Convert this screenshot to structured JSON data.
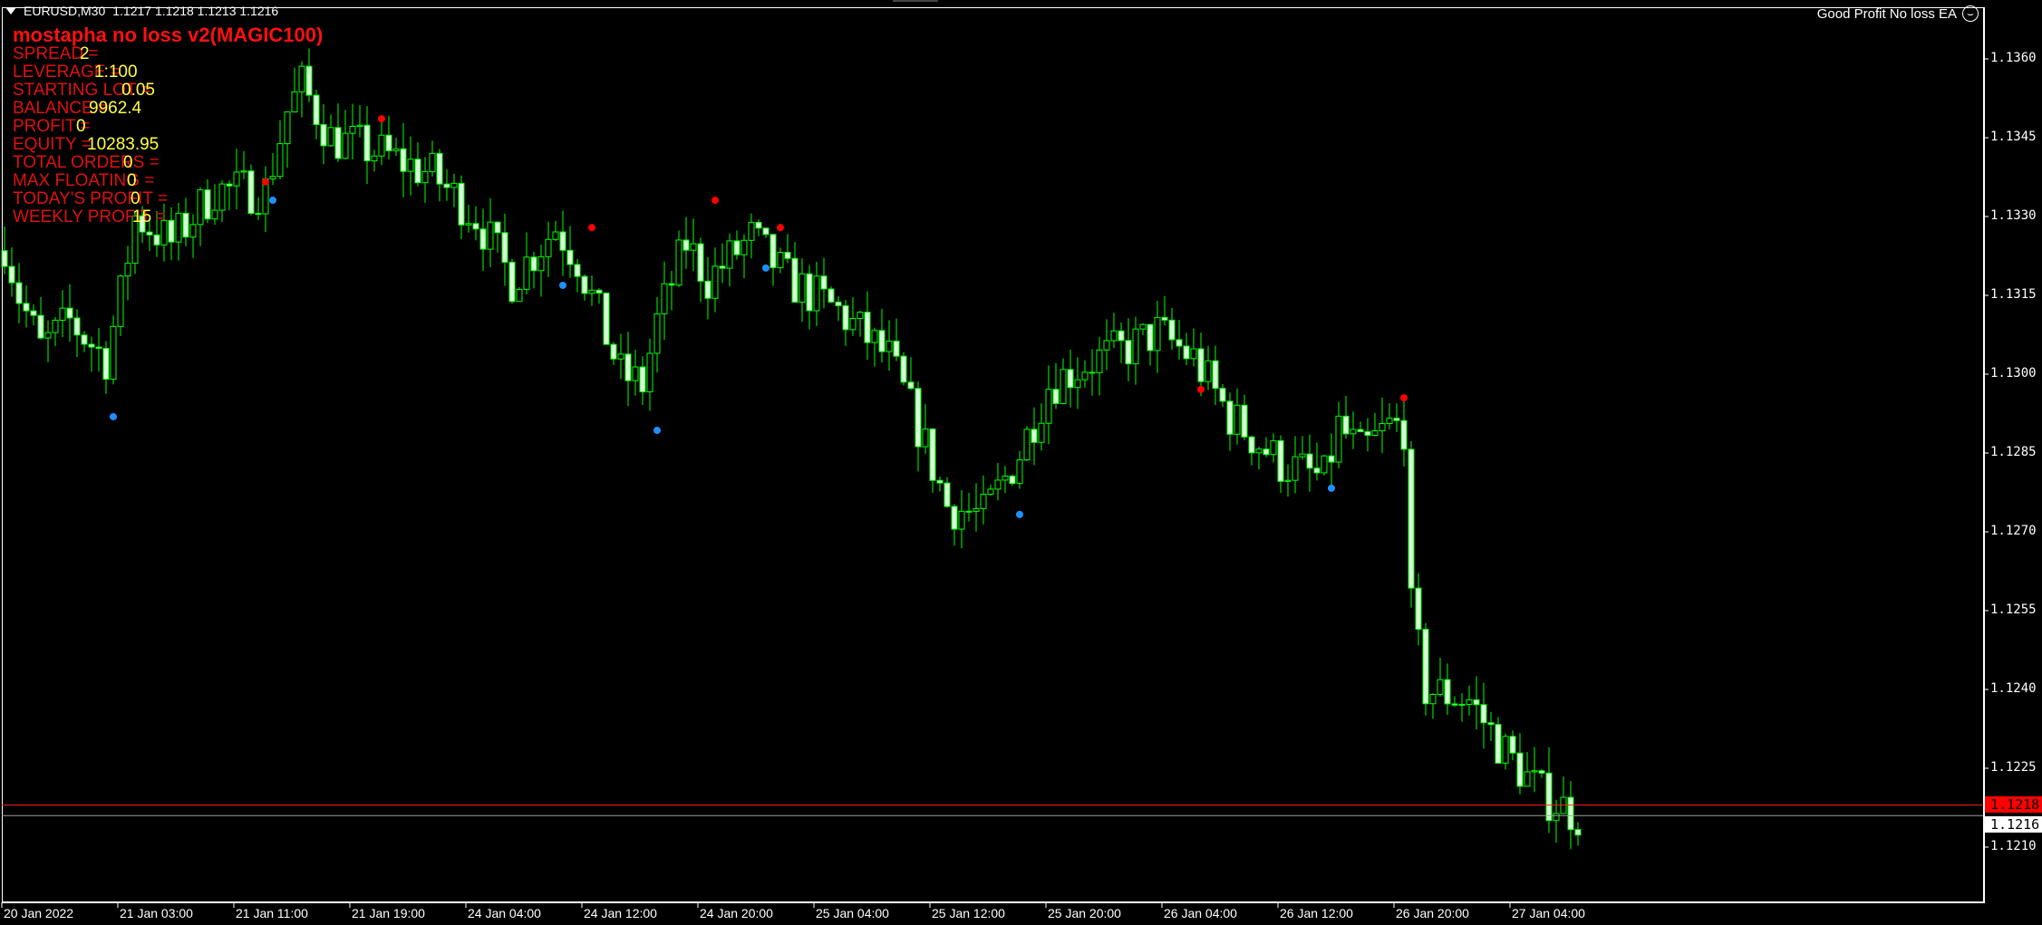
{
  "header": {
    "symbol": "EURUSD,M30",
    "ohlc": "1.1217 1.1218 1.1213 1.1216"
  },
  "ea_label": "Good Profit No loss EA",
  "ea_icon": "smiley-icon",
  "panel": {
    "title": "mostapha no loss v2(MAGIC100)",
    "rows": [
      {
        "label": "SPREAD =",
        "value": "2"
      },
      {
        "label": "LEVERAGE =",
        "value": "1:100"
      },
      {
        "label": "STARTING LOT =",
        "value": "0.05"
      },
      {
        "label": "BALANCE =",
        "value": "9962.4"
      },
      {
        "label": "PROFIT =",
        "value": "0"
      },
      {
        "label": "EQUITY =",
        "value": "10283.95"
      },
      {
        "label": "TOTAL ORDERS =",
        "value": "0"
      },
      {
        "label": "MAX FLOATING =",
        "value": "0"
      },
      {
        "label": "TODAY'S PROFIT =",
        "value": "0"
      },
      {
        "label": "WEEKLY PROFIT =",
        "value": "15"
      }
    ]
  },
  "price_tags": {
    "ask": "1.1218",
    "bid": "1.1216",
    "ask_color": "#ff0000"
  },
  "colors": {
    "candle": "#00ff00",
    "bear_body": "#d8ffd8",
    "sell_dot": "#ff0000",
    "buy_dot": "#1e90ff"
  },
  "chart_data": {
    "type": "candlestick",
    "symbol": "EURUSD",
    "timeframe": "M30",
    "ylim": [
      1.1203,
      1.1368
    ],
    "y_ticks": [
      "1.1360",
      "1.1345",
      "1.1330",
      "1.1315",
      "1.1300",
      "1.1285",
      "1.1270",
      "1.1255",
      "1.1240",
      "1.1225",
      "1.1210"
    ],
    "x_ticks": [
      "20 Jan 2022",
      "21 Jan 03:00",
      "21 Jan 11:00",
      "21 Jan 19:00",
      "24 Jan 04:00",
      "24 Jan 12:00",
      "24 Jan 20:00",
      "25 Jan 04:00",
      "25 Jan 12:00",
      "25 Jan 20:00",
      "26 Jan 04:00",
      "26 Jan 12:00",
      "26 Jan 20:00",
      "27 Jan 04:00"
    ],
    "bars_per_tick": 16,
    "close_path": [
      [
        0,
        1.1325
      ],
      [
        2,
        1.1315
      ],
      [
        5,
        1.1305
      ],
      [
        9,
        1.131
      ],
      [
        14,
        1.1303
      ],
      [
        16,
        1.1315
      ],
      [
        18,
        1.133
      ],
      [
        23,
        1.1325
      ],
      [
        29,
        1.1335
      ],
      [
        36,
        1.1335
      ],
      [
        39,
        1.135
      ],
      [
        41,
        1.1355
      ],
      [
        45,
        1.1345
      ],
      [
        52,
        1.1342
      ],
      [
        59,
        1.1338
      ],
      [
        65,
        1.133
      ],
      [
        70,
        1.1318
      ],
      [
        76,
        1.1328
      ],
      [
        79,
        1.1322
      ],
      [
        85,
        1.13
      ],
      [
        88,
        1.1298
      ],
      [
        90,
        1.131
      ],
      [
        94,
        1.1325
      ],
      [
        97,
        1.1318
      ],
      [
        103,
        1.1326
      ],
      [
        108,
        1.1318
      ],
      [
        115,
        1.1312
      ],
      [
        122,
        1.1303
      ],
      [
        126,
        1.129
      ],
      [
        130,
        1.1275
      ],
      [
        135,
        1.1273
      ],
      [
        140,
        1.1285
      ],
      [
        144,
        1.1298
      ],
      [
        149,
        1.1302
      ],
      [
        155,
        1.1305
      ],
      [
        159,
        1.1308
      ],
      [
        164,
        1.1303
      ],
      [
        169,
        1.1292
      ],
      [
        176,
        1.1283
      ],
      [
        182,
        1.128
      ],
      [
        184,
        1.129
      ],
      [
        187,
        1.1285
      ],
      [
        191,
        1.129
      ],
      [
        193,
        1.129
      ],
      [
        194,
        1.1255
      ],
      [
        196,
        1.124
      ],
      [
        202,
        1.1238
      ],
      [
        207,
        1.1228
      ],
      [
        212,
        1.122
      ],
      [
        217,
        1.1216
      ]
    ],
    "sell_signals": [
      [
        36,
        1.13366
      ],
      [
        52,
        1.13486
      ],
      [
        81,
        1.13279
      ],
      [
        98,
        1.13331
      ],
      [
        107,
        1.13279
      ],
      [
        165,
        1.12971
      ],
      [
        193,
        1.12955
      ]
    ],
    "buy_signals": [
      [
        15,
        1.12919
      ],
      [
        37,
        1.13331
      ],
      [
        77,
        1.13169
      ],
      [
        90,
        1.12893
      ],
      [
        105,
        1.13202
      ],
      [
        140,
        1.12733
      ],
      [
        183,
        1.12783
      ]
    ],
    "ask_line": 1.1218,
    "bid_line": 1.1216
  }
}
